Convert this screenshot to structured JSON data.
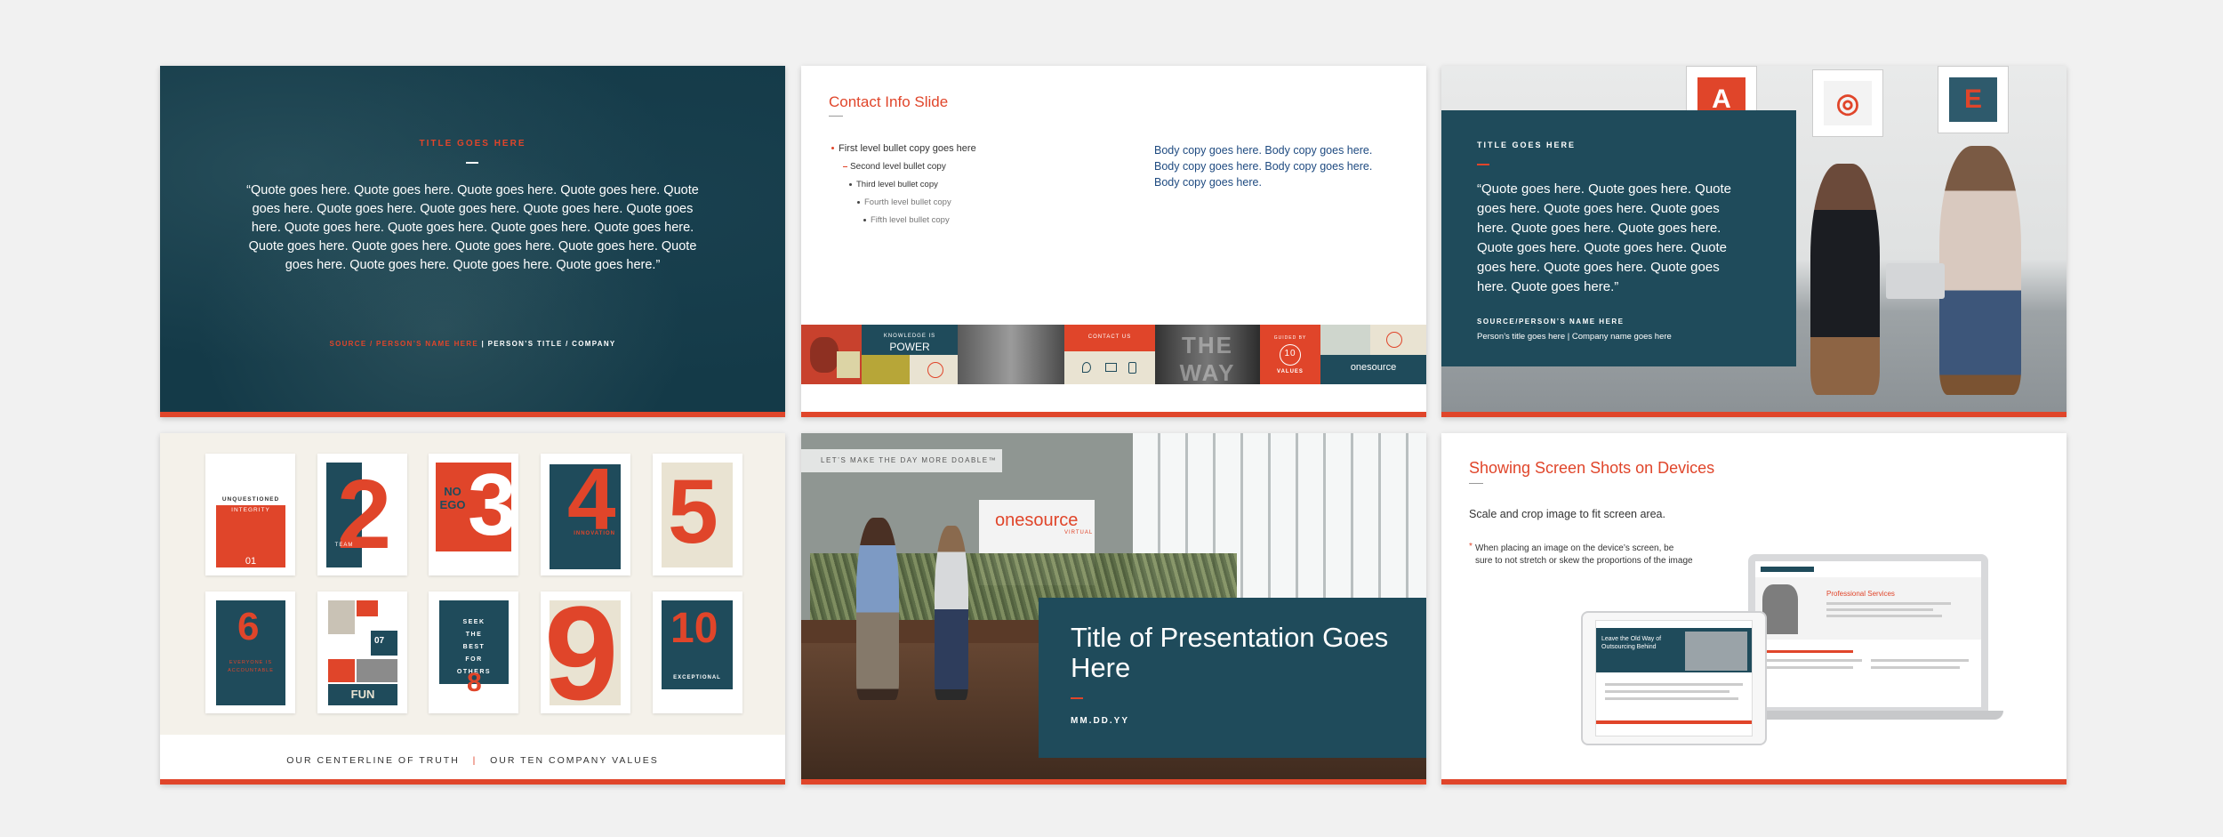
{
  "slide1": {
    "kicker": "TITLE GOES HERE",
    "quote": "“Quote goes here. Quote goes here. Quote goes here. Quote goes here. Quote goes here. Quote goes here. Quote goes here. Quote goes here. Quote goes here. Quote goes here. Quote goes here. Quote goes here. Quote goes here. Quote goes here. Quote goes here. Quote goes here. Quote goes here. Quote goes here. Quote goes here. Quote goes here. Quote goes here.”",
    "source": "SOURCE / PERSON’S NAME HERE",
    "title_company": " | PERSON’S TITLE / COMPANY"
  },
  "slide2": {
    "title": "Contact Info Slide",
    "bullets": [
      "First level bullet copy goes here",
      "Second level bullet copy",
      "Third level bullet copy",
      "Fourth level bullet copy",
      "Fifth level bullet copy"
    ],
    "body": "Body copy goes here. Body copy goes here. Body copy goes here. Body copy goes here. Body copy goes here.",
    "strip": {
      "power_small": "KNOWLEDGE IS",
      "power": "POWER",
      "contact": "CONTACT US",
      "way": "THE WAY",
      "guided": "GUIDED BY",
      "ten": "10",
      "values": "VALUES",
      "brand": "onesource"
    }
  },
  "slide3": {
    "frames": [
      "A",
      "◎",
      "E"
    ],
    "kicker": "TITLE GOES HERE",
    "quote": "“Quote goes here. Quote goes here. Quote goes here. Quote goes here. Quote goes here. Quote goes here. Quote goes here. Quote goes here. Quote goes here. Quote goes here. Quote goes here. Quote goes here. Quote goes here.”",
    "source": "SOURCE/PERSON’S NAME HERE",
    "sub": "Person’s title goes here  |  Company name goes here"
  },
  "slide4": {
    "card1": {
      "line1": "UNQUESTIONED",
      "line2": "INTEGRITY",
      "num": "01"
    },
    "card2": {
      "num": "2",
      "label": "TEAM"
    },
    "card3": {
      "num": "3",
      "label": "NO EGO"
    },
    "card4": {
      "num": "4",
      "label": "INNOVATION"
    },
    "card5": {
      "num": "5"
    },
    "card6": {
      "num": "6",
      "label": "EVERYONE IS ACCOUNTABLE"
    },
    "card7": {
      "num": "07",
      "label": "FUN"
    },
    "card8": {
      "text": "SEEK THE BEST FOR OTHERS",
      "num": "8"
    },
    "card9": {
      "num": "9"
    },
    "card10": {
      "num": "10",
      "label": "EXCEPTIONAL"
    },
    "footer_left": "OUR CENTERLINE OF TRUTH",
    "footer_sep": "|",
    "footer_right": "OUR TEN COMPANY VALUES"
  },
  "slide5": {
    "tag": "LET’S MAKE THE DAY MORE DOABLE™",
    "brand": "onesource",
    "brand_sub": "VIRTUAL",
    "title": "Title of Presentation Goes Here",
    "date": "MM.DD.YY"
  },
  "slide6": {
    "title": "Showing Screen Shots on Devices",
    "intro": "Scale and crop image to fit screen area.",
    "star": "*",
    "note": "When placing an image on the device’s screen, be sure to not stretch or skew the proportions of the image",
    "laptop_heading": "Professional Services",
    "tablet_heading": "Leave the Old Way of Outsourcing Behind"
  },
  "colors": {
    "accent": "#e0452a",
    "teal": "#1f4b5b",
    "navy_text": "#1e4a80"
  }
}
